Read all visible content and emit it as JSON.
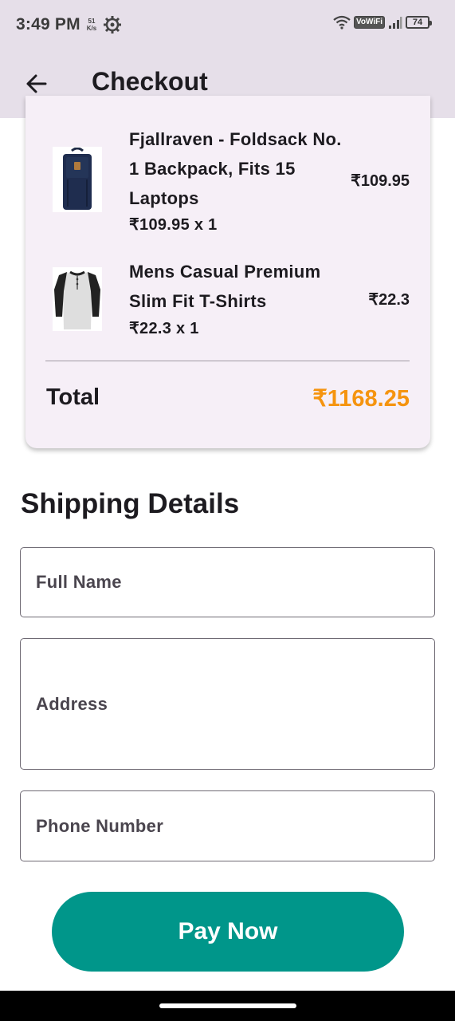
{
  "status_bar": {
    "time": "3:49 PM",
    "speed_value": "51",
    "speed_unit": "K/s",
    "vowifi": "VoWiFi",
    "battery": "74"
  },
  "app_bar": {
    "back_icon": "arrow-left-icon",
    "title": "Checkout"
  },
  "order": {
    "items": [
      {
        "title": "Fjallraven - Foldsack No. 1 Backpack, Fits 15 Laptops",
        "qty_line": "₹109.95 x 1",
        "price": "₹109.95",
        "image": "backpack-image"
      },
      {
        "title": "Mens Casual Premium Slim Fit T-Shirts",
        "qty_line": "₹22.3 x 1",
        "price": "₹22.3",
        "image": "tshirt-image"
      }
    ],
    "total_label": "Total",
    "total_value": "₹1168.25",
    "total_color": "#f5940f"
  },
  "shipping": {
    "title": "Shipping Details",
    "full_name_label": "Full Name",
    "address_label": "Address",
    "phone_label": "Phone Number"
  },
  "pay_button": {
    "label": "Pay Now",
    "color": "#00968a"
  }
}
